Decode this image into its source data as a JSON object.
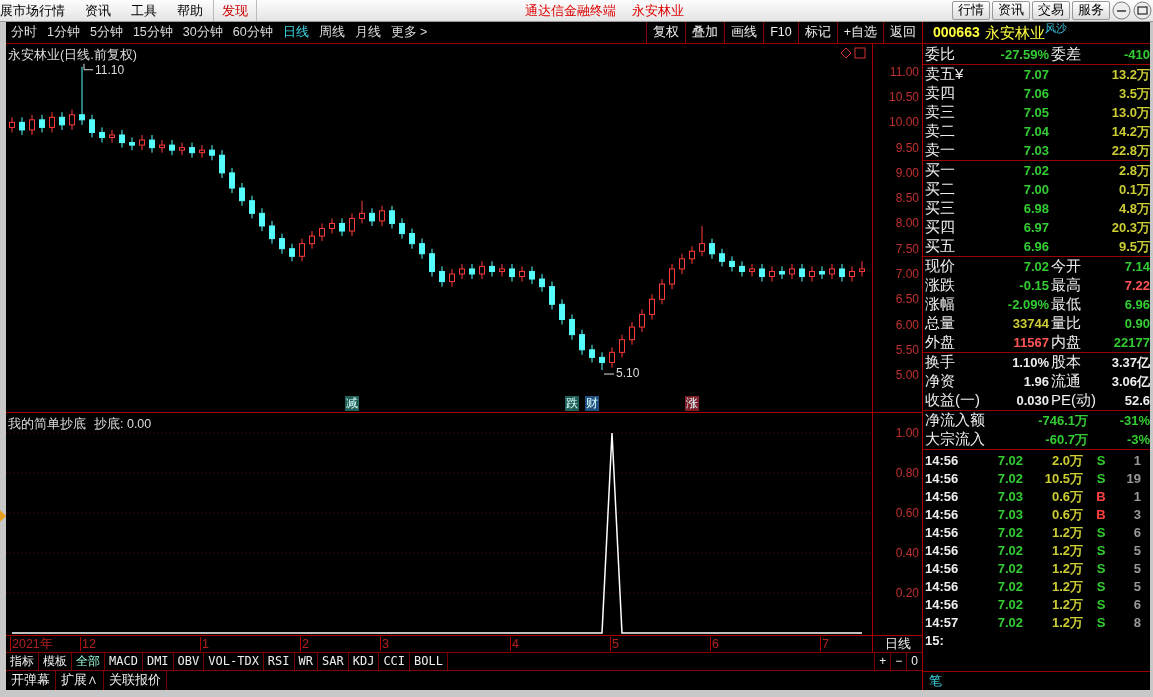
{
  "menu_bar": {
    "menus": [
      "展市场行情",
      "资讯",
      "工具",
      "帮助"
    ],
    "discover": "发现",
    "app_title": "通达信金融终端",
    "stock_title": "永安林业",
    "buttons": [
      "行情",
      "资讯",
      "交易",
      "服务"
    ]
  },
  "period_tabs": [
    {
      "label": "分时",
      "selected": false
    },
    {
      "label": "1分钟",
      "selected": false
    },
    {
      "label": "5分钟",
      "selected": false
    },
    {
      "label": "15分钟",
      "selected": false
    },
    {
      "label": "30分钟",
      "selected": false
    },
    {
      "label": "60分钟",
      "selected": false
    },
    {
      "label": "日线",
      "selected": true
    },
    {
      "label": "周线",
      "selected": false
    },
    {
      "label": "月线",
      "selected": false
    },
    {
      "label": "更多 >",
      "selected": false
    }
  ],
  "chart_tools": [
    "复权",
    "叠加",
    "画线",
    "F10",
    "标记",
    "+自选",
    "返回"
  ],
  "main_chart": {
    "title": "永安林业(日线.前复权)",
    "high_label": "11.10",
    "low_label": "5.10",
    "chart_data": {
      "type": "candlestick",
      "ylim": [
        4.25,
        11.55
      ],
      "yticks": [
        {
          "value": 11,
          "label": "11.00"
        },
        {
          "value": 10.5,
          "label": "10.50"
        },
        {
          "value": 10,
          "label": "10.00"
        },
        {
          "value": 9.5,
          "label": "9.50"
        },
        {
          "value": 9,
          "label": "9.00"
        },
        {
          "value": 8.5,
          "label": "8.50"
        },
        {
          "value": 8,
          "label": "8.00"
        },
        {
          "value": 7.5,
          "label": "7.50"
        },
        {
          "value": 7,
          "label": "7.00"
        },
        {
          "value": 6.5,
          "label": "6.50"
        },
        {
          "value": 6,
          "label": "6.00"
        },
        {
          "value": 5.5,
          "label": "5.50"
        },
        {
          "value": 5,
          "label": "5.00"
        }
      ],
      "ohlc": [
        [
          9.9,
          10.1,
          9.8,
          10.0
        ],
        [
          10.0,
          10.1,
          9.75,
          9.85
        ],
        [
          9.85,
          10.15,
          9.75,
          10.05
        ],
        [
          10.05,
          10.15,
          9.8,
          9.9
        ],
        [
          9.9,
          10.2,
          9.8,
          10.1
        ],
        [
          10.1,
          10.2,
          9.85,
          9.95
        ],
        [
          9.95,
          10.25,
          9.85,
          10.15
        ],
        [
          10.15,
          11.1,
          9.95,
          10.05
        ],
        [
          10.05,
          10.15,
          9.7,
          9.8
        ],
        [
          9.8,
          9.9,
          9.6,
          9.7
        ],
        [
          9.7,
          9.85,
          9.6,
          9.75
        ],
        [
          9.75,
          9.85,
          9.5,
          9.6
        ],
        [
          9.6,
          9.7,
          9.45,
          9.55
        ],
        [
          9.55,
          9.75,
          9.45,
          9.65
        ],
        [
          9.65,
          9.75,
          9.4,
          9.5
        ],
        [
          9.5,
          9.65,
          9.4,
          9.55
        ],
        [
          9.55,
          9.65,
          9.35,
          9.45
        ],
        [
          9.45,
          9.6,
          9.35,
          9.5
        ],
        [
          9.5,
          9.6,
          9.3,
          9.4
        ],
        [
          9.4,
          9.55,
          9.3,
          9.45
        ],
        [
          9.45,
          9.55,
          9.25,
          9.35
        ],
        [
          9.35,
          9.45,
          8.9,
          9.0
        ],
        [
          9.0,
          9.1,
          8.6,
          8.7
        ],
        [
          8.7,
          8.8,
          8.35,
          8.45
        ],
        [
          8.45,
          8.55,
          8.1,
          8.2
        ],
        [
          8.2,
          8.3,
          7.85,
          7.95
        ],
        [
          7.95,
          8.05,
          7.6,
          7.7
        ],
        [
          7.7,
          7.8,
          7.4,
          7.5
        ],
        [
          7.5,
          7.6,
          7.25,
          7.35
        ],
        [
          7.35,
          7.7,
          7.25,
          7.6
        ],
        [
          7.6,
          7.85,
          7.5,
          7.75
        ],
        [
          7.75,
          8.0,
          7.65,
          7.9
        ],
        [
          7.9,
          8.1,
          7.8,
          8.0
        ],
        [
          8.0,
          8.1,
          7.75,
          7.85
        ],
        [
          7.85,
          8.2,
          7.75,
          8.1
        ],
        [
          8.1,
          8.45,
          8.0,
          8.2
        ],
        [
          8.2,
          8.3,
          7.95,
          8.05
        ],
        [
          8.05,
          8.35,
          7.95,
          8.25
        ],
        [
          8.25,
          8.35,
          7.9,
          8.0
        ],
        [
          8.0,
          8.1,
          7.7,
          7.8
        ],
        [
          7.8,
          7.9,
          7.5,
          7.6
        ],
        [
          7.6,
          7.7,
          7.3,
          7.4
        ],
        [
          7.4,
          7.5,
          6.95,
          7.05
        ],
        [
          7.05,
          7.15,
          6.75,
          6.85
        ],
        [
          6.85,
          7.1,
          6.75,
          7.0
        ],
        [
          7.0,
          7.2,
          6.9,
          7.1
        ],
        [
          7.1,
          7.2,
          6.9,
          7.0
        ],
        [
          7.0,
          7.25,
          6.9,
          7.15
        ],
        [
          7.15,
          7.25,
          6.95,
          7.05
        ],
        [
          7.05,
          7.2,
          6.95,
          7.1
        ],
        [
          7.1,
          7.2,
          6.85,
          6.95
        ],
        [
          6.95,
          7.15,
          6.85,
          7.05
        ],
        [
          7.05,
          7.15,
          6.8,
          6.9
        ],
        [
          6.9,
          7.0,
          6.65,
          6.75
        ],
        [
          6.75,
          6.85,
          6.3,
          6.4
        ],
        [
          6.4,
          6.5,
          6.0,
          6.1
        ],
        [
          6.1,
          6.2,
          5.7,
          5.8
        ],
        [
          5.8,
          5.9,
          5.4,
          5.5
        ],
        [
          5.5,
          5.6,
          5.25,
          5.35
        ],
        [
          5.35,
          5.45,
          5.1,
          5.25
        ],
        [
          5.25,
          5.55,
          5.15,
          5.45
        ],
        [
          5.45,
          5.8,
          5.35,
          5.7
        ],
        [
          5.7,
          6.05,
          5.6,
          5.95
        ],
        [
          5.95,
          6.3,
          5.85,
          6.2
        ],
        [
          6.2,
          6.6,
          6.1,
          6.5
        ],
        [
          6.5,
          6.9,
          6.4,
          6.8
        ],
        [
          6.8,
          7.2,
          6.7,
          7.1
        ],
        [
          7.1,
          7.4,
          7.0,
          7.3
        ],
        [
          7.3,
          7.55,
          7.2,
          7.45
        ],
        [
          7.45,
          7.95,
          7.35,
          7.6
        ],
        [
          7.6,
          7.7,
          7.3,
          7.4
        ],
        [
          7.4,
          7.5,
          7.15,
          7.25
        ],
        [
          7.25,
          7.35,
          7.05,
          7.15
        ],
        [
          7.15,
          7.25,
          6.95,
          7.05
        ],
        [
          7.05,
          7.2,
          6.95,
          7.1
        ],
        [
          7.1,
          7.2,
          6.85,
          6.95
        ],
        [
          6.95,
          7.15,
          6.85,
          7.05
        ],
        [
          7.05,
          7.15,
          6.9,
          7.0
        ],
        [
          7.0,
          7.2,
          6.9,
          7.1
        ],
        [
          7.1,
          7.2,
          6.85,
          6.95
        ],
        [
          6.95,
          7.15,
          6.85,
          7.05
        ],
        [
          7.05,
          7.15,
          6.9,
          7.0
        ],
        [
          7.0,
          7.2,
          6.9,
          7.1
        ],
        [
          7.1,
          7.2,
          6.85,
          6.95
        ],
        [
          6.95,
          7.15,
          6.85,
          7.05
        ],
        [
          7.05,
          7.25,
          6.95,
          7.1
        ]
      ]
    },
    "event_marks": [
      {
        "label": "减",
        "color": "#1f5f55"
      },
      {
        "label": "跌",
        "color": "#1f5f55"
      },
      {
        "label": "财",
        "color": "#1f4f7f"
      },
      {
        "label": "涨",
        "color": "#7f1f2a"
      }
    ]
  },
  "indicator": {
    "name": "我的简单抄底",
    "reading": "抄底: 0.00",
    "chart_data": {
      "type": "line",
      "grid": true,
      "ylim": [
        -0.01,
        1.1
      ],
      "yticks": [
        {
          "value": 1,
          "label": "1.00"
        },
        {
          "value": 0.8,
          "label": "0.80"
        },
        {
          "value": 0.6,
          "label": "0.60"
        },
        {
          "value": 0.4,
          "label": "0.40"
        },
        {
          "value": 0.2,
          "label": "0.20"
        }
      ],
      "values": [
        0,
        0,
        0,
        0,
        0,
        0,
        0,
        0,
        0,
        0,
        0,
        0,
        0,
        0,
        0,
        0,
        0,
        0,
        0,
        0,
        0,
        0,
        0,
        0,
        0,
        0,
        0,
        0,
        0,
        0,
        0,
        0,
        0,
        0,
        0,
        0,
        0,
        0,
        0,
        0,
        0,
        0,
        0,
        0,
        0,
        0,
        0,
        0,
        0,
        0,
        0,
        0,
        0,
        0,
        0,
        0,
        0,
        0,
        0,
        0,
        1,
        0,
        0,
        0,
        0,
        0,
        0,
        0,
        0,
        0,
        0,
        0,
        0,
        0,
        0,
        0,
        0,
        0,
        0,
        0,
        0,
        0,
        0,
        0,
        0,
        0
      ]
    }
  },
  "date_axis": {
    "labels": [
      "2021年",
      "12",
      "1",
      "2",
      "3",
      "4",
      "5",
      "6",
      "7"
    ],
    "period": "日线",
    "zoom_buttons": [
      "+",
      "−",
      "0"
    ]
  },
  "indicator_tabs": [
    {
      "label": "指标",
      "selected": false
    },
    {
      "label": "模板",
      "selected": false
    },
    {
      "label": "全部",
      "selected": true
    },
    {
      "label": "MACD",
      "selected": false
    },
    {
      "label": "DMI",
      "selected": false
    },
    {
      "label": "OBV",
      "selected": false
    },
    {
      "label": "VOL-TDX",
      "selected": false
    },
    {
      "label": "RSI",
      "selected": false
    },
    {
      "label": "WR",
      "selected": false
    },
    {
      "label": "SAR",
      "selected": false
    },
    {
      "label": "KDJ",
      "selected": false
    },
    {
      "label": "CCI",
      "selected": false
    },
    {
      "label": "BOLL",
      "selected": false
    }
  ],
  "bottom_tabs": [
    "开弹幕",
    "扩展∧",
    "关联报价"
  ],
  "quote": {
    "code": "000663",
    "name": "永安林业",
    "tag": "风沙",
    "ratio": {
      "label": "委比",
      "value": "-27.59%",
      "diff_label": "委差",
      "diff": "-410"
    },
    "asks": [
      {
        "label": "卖五¥",
        "price": "7.07",
        "volume": "13.2万"
      },
      {
        "label": "卖四",
        "price": "7.06",
        "volume": "3.5万"
      },
      {
        "label": "卖三",
        "price": "7.05",
        "volume": "13.0万"
      },
      {
        "label": "卖二",
        "price": "7.04",
        "volume": "14.2万"
      },
      {
        "label": "卖一",
        "price": "7.03",
        "volume": "22.8万"
      }
    ],
    "bids": [
      {
        "label": "买一",
        "price": "7.02",
        "volume": "2.8万"
      },
      {
        "label": "买二",
        "price": "7.00",
        "volume": "0.1万"
      },
      {
        "label": "买三",
        "price": "6.98",
        "volume": "4.8万"
      },
      {
        "label": "买四",
        "price": "6.97",
        "volume": "20.3万"
      },
      {
        "label": "买五",
        "price": "6.96",
        "volume": "9.5万"
      }
    ],
    "stats": [
      {
        "left": {
          "label": "现价",
          "value": "7.02",
          "color": "#33cc33"
        },
        "right": {
          "label": "今开",
          "value": "7.14",
          "color": "#33cc33"
        }
      },
      {
        "left": {
          "label": "涨跌",
          "value": "-0.15",
          "color": "#33cc33"
        },
        "right": {
          "label": "最高",
          "value": "7.22",
          "color": "#ff5555"
        }
      },
      {
        "left": {
          "label": "涨幅",
          "value": "-2.09%",
          "color": "#33cc33"
        },
        "right": {
          "label": "最低",
          "value": "6.96",
          "color": "#33cc33"
        }
      },
      {
        "left": {
          "label": "总量",
          "value": "33744",
          "color": "#cccc33"
        },
        "right": {
          "label": "量比",
          "value": "0.90",
          "color": "#33cc33"
        }
      },
      {
        "left": {
          "label": "外盘",
          "value": "11567",
          "color": "#ff5555"
        },
        "right": {
          "label": "内盘",
          "value": "22177",
          "color": "#33cc33"
        }
      }
    ],
    "fundamentals": [
      {
        "label": "换手",
        "value": "1.10%",
        "label2": "股本",
        "value2": "3.37亿"
      },
      {
        "label": "净资",
        "value": "1.96",
        "label2": "流通",
        "value2": "3.06亿"
      },
      {
        "label": "收益(一)",
        "value": "0.030",
        "label2": "PE(动)",
        "value2": "52.6"
      }
    ],
    "flows": [
      {
        "label": "净流入额",
        "amount": "-746.1万",
        "percent": "-31%"
      },
      {
        "label": "大宗流入",
        "amount": "-60.7万",
        "percent": "-3%"
      }
    ],
    "ticks": [
      {
        "time": "14:56",
        "price": {
          "text": "7.02",
          "color": "#33cc33"
        },
        "volume": "2.0万",
        "side": {
          "text": "S",
          "color": "#33cc33"
        },
        "count": "1"
      },
      {
        "time": "14:56",
        "price": {
          "text": "7.02",
          "color": "#33cc33"
        },
        "volume": "10.5万",
        "side": {
          "text": "S",
          "color": "#33cc33"
        },
        "count": "19"
      },
      {
        "time": "14:56",
        "price": {
          "text": "7.03",
          "color": "#33cc33"
        },
        "volume": "0.6万",
        "side": {
          "text": "B",
          "color": "#ff4040"
        },
        "count": "1"
      },
      {
        "time": "14:56",
        "price": {
          "text": "7.03",
          "color": "#33cc33"
        },
        "volume": "0.6万",
        "side": {
          "text": "B",
          "color": "#ff4040"
        },
        "count": "3"
      },
      {
        "time": "14:56",
        "price": {
          "text": "7.02",
          "color": "#33cc33"
        },
        "volume": "1.2万",
        "side": {
          "text": "S",
          "color": "#33cc33"
        },
        "count": "6"
      },
      {
        "time": "14:56",
        "price": {
          "text": "7.02",
          "color": "#33cc33"
        },
        "volume": "1.2万",
        "side": {
          "text": "S",
          "color": "#33cc33"
        },
        "count": "5"
      },
      {
        "time": "14:56",
        "price": {
          "text": "7.02",
          "color": "#33cc33"
        },
        "volume": "1.2万",
        "side": {
          "text": "S",
          "color": "#33cc33"
        },
        "count": "5"
      },
      {
        "time": "14:56",
        "price": {
          "text": "7.02",
          "color": "#33cc33"
        },
        "volume": "1.2万",
        "side": {
          "text": "S",
          "color": "#33cc33"
        },
        "count": "5"
      },
      {
        "time": "14:56",
        "price": {
          "text": "7.02",
          "color": "#33cc33"
        },
        "volume": "1.2万",
        "side": {
          "text": "S",
          "color": "#33cc33"
        },
        "count": "6"
      },
      {
        "time": "14:57",
        "price": {
          "text": "7.02",
          "color": "#33cc33"
        },
        "volume": "1.2万",
        "side": {
          "text": "S",
          "color": "#33cc33"
        },
        "count": "8"
      },
      {
        "time": "15:"
      }
    ],
    "detail_tab": "笔"
  }
}
